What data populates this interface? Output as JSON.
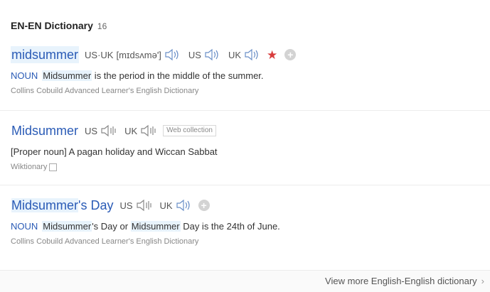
{
  "header": {
    "title": "EN-EN Dictionary",
    "count": "16"
  },
  "entries": [
    {
      "headword": "midsummer",
      "pron_both_label": "US·UK",
      "phonetic": "[mɪdsʌmə']",
      "us_label": "US",
      "uk_label": "UK",
      "definition": {
        "pos": "NOUN",
        "highlight": "Midsummer",
        "text": " is the period in the middle of the summer."
      },
      "source": "Collins Cobuild Advanced Learner's English Dictionary"
    },
    {
      "headword": "Midsummer",
      "us_label": "US",
      "uk_label": "UK",
      "tag": "Web collection",
      "definition_text": "[Proper noun] A pagan holiday and Wiccan Sabbat",
      "source": "Wiktionary"
    },
    {
      "headword": "Midsummer's Day",
      "headword_highlight": "Midsummer",
      "headword_rest": "'s Day",
      "us_label": "US",
      "uk_label": "UK",
      "definition": {
        "pos": "NOUN",
        "highlight1": "Midsummer",
        "text1": "'s Day or ",
        "highlight2": "Midsummer",
        "text2": " Day is the 24th of June."
      },
      "source": "Collins Cobuild Advanced Learner's English Dictionary"
    }
  ],
  "footer": {
    "view_more": "View more English-English dictionary"
  },
  "icons": {
    "speaker": "speaker-icon",
    "star": "star-icon",
    "add": "add-icon",
    "copy": "copy-icon",
    "chevron": "chevron-right-icon"
  },
  "colors": {
    "headword": "#2a5bb6",
    "highlight": "#e8f3fc",
    "star": "#d83c3c"
  }
}
